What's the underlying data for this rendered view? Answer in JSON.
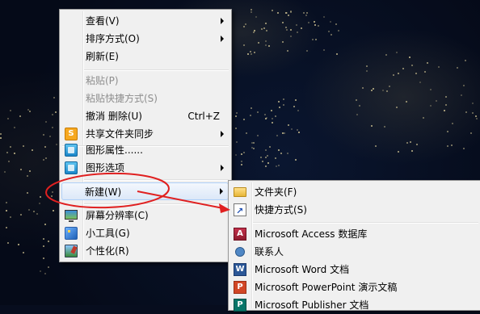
{
  "context_menu": {
    "items": [
      {
        "label": "查看(V)",
        "has_submenu": true
      },
      {
        "label": "排序方式(O)",
        "has_submenu": true
      },
      {
        "label": "刷新(E)"
      },
      {
        "label": "粘贴(P)",
        "disabled": true
      },
      {
        "label": "粘贴快捷方式(S)",
        "disabled": true
      },
      {
        "label": "撤消 删除(U)",
        "shortcut": "Ctrl+Z"
      },
      {
        "label": "共享文件夹同步",
        "has_submenu": true,
        "icon": "sync-icon"
      },
      {
        "label": "图形属性......",
        "icon": "graphics-properties-icon"
      },
      {
        "label": "图形选项",
        "has_submenu": true,
        "icon": "graphics-options-icon"
      },
      {
        "label": "新建(W)",
        "has_submenu": true,
        "highlighted": true
      },
      {
        "label": "屏幕分辨率(C)",
        "icon": "monitor-icon"
      },
      {
        "label": "小工具(G)",
        "icon": "gadgets-icon"
      },
      {
        "label": "个性化(R)",
        "icon": "personalize-icon"
      }
    ]
  },
  "new_submenu": {
    "items": [
      {
        "label": "文件夹(F)",
        "icon": "folder-icon"
      },
      {
        "label": "快捷方式(S)",
        "icon": "shortcut-icon"
      },
      {
        "label": "Microsoft Access 数据库",
        "icon": "access-icon"
      },
      {
        "label": "联系人",
        "icon": "contact-icon"
      },
      {
        "label": "Microsoft Word 文档",
        "icon": "word-icon"
      },
      {
        "label": "Microsoft PowerPoint 演示文稿",
        "icon": "powerpoint-icon"
      },
      {
        "label": "Microsoft Publisher 文档",
        "icon": "publisher-icon"
      }
    ]
  },
  "annotation": {
    "color": "#e02020"
  }
}
